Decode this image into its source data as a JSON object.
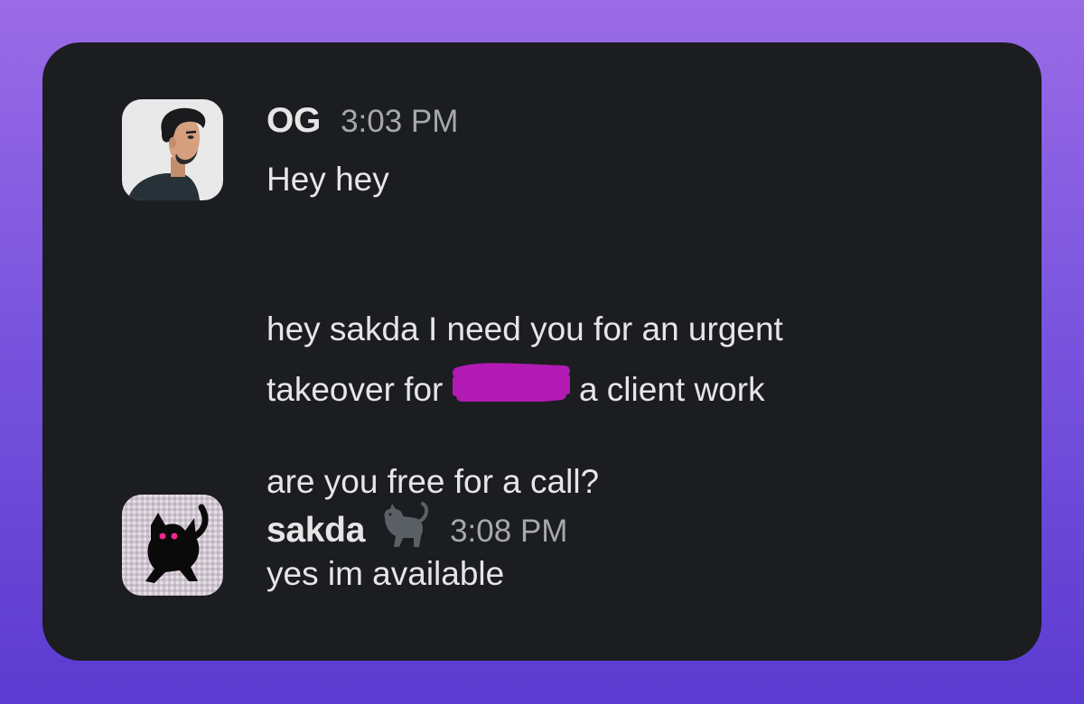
{
  "messages": [
    {
      "sender": "OG",
      "time": "3:03 PM",
      "avatar_icon": "user-portrait-avatar",
      "lines": {
        "l1": "Hey hey",
        "l2": "hey sakda I need you for an urgent",
        "l3_before": "takeover for",
        "l3_after": "a client work",
        "l4": "are you free for a call?"
      },
      "redaction_color": "#b21ab4"
    },
    {
      "sender": "sakda",
      "status_icon": "cat-emoji-icon",
      "time": "3:08 PM",
      "avatar_icon": "black-cat-avatar",
      "lines": {
        "l1": "yes im available"
      }
    }
  ]
}
